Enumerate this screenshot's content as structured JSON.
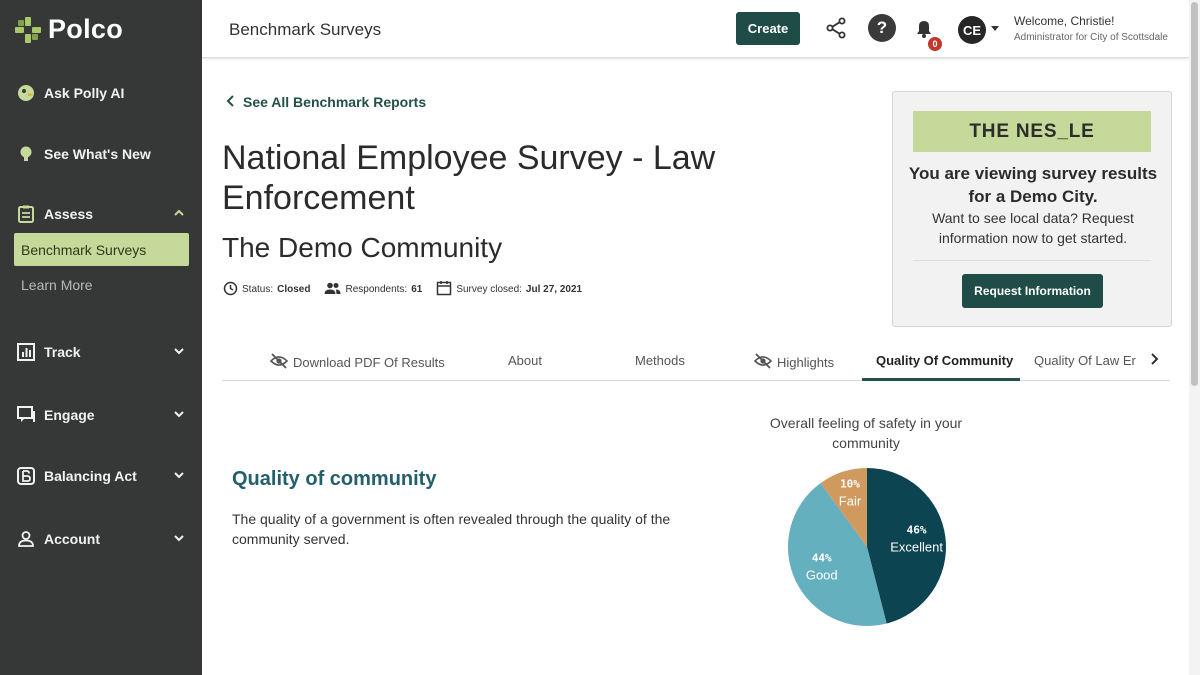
{
  "sidebar": {
    "logo": "Polco",
    "items": [
      {
        "label": "Ask Polly AI"
      },
      {
        "label": "See What's New"
      },
      {
        "label": "Assess"
      },
      {
        "label": "Track"
      },
      {
        "label": "Engage"
      },
      {
        "label": "Balancing Act"
      },
      {
        "label": "Account"
      }
    ],
    "assess_sub": {
      "active": "Benchmark Surveys",
      "other": "Learn More"
    }
  },
  "header": {
    "title": "Benchmark Surveys",
    "create_label": "Create",
    "notification_count": "0",
    "avatar_initials": "CE",
    "welcome": "Welcome, Christie!",
    "role": "Administrator for City of Scottsdale"
  },
  "main": {
    "back_link": "See All Benchmark Reports",
    "survey_title": "National Employee Survey - Law Enforcement",
    "community": "The Demo Community",
    "meta": {
      "status_label": "Status:",
      "status": "Closed",
      "respondents_label": "Respondents:",
      "respondents": "61",
      "closed_label": "Survey closed:",
      "closed": "Jul 27, 2021"
    },
    "tabs": [
      "Download PDF Of Results",
      "About",
      "Methods",
      "Highlights",
      "Quality Of Community",
      "Quality Of Law Er"
    ],
    "section": {
      "title": "Quality of community",
      "description": "The quality of a government is often revealed through the quality of the community served."
    }
  },
  "demo_card": {
    "banner": "THE NES_LE",
    "headline": "You are viewing survey results for a Demo City.",
    "body": "Want to see local data? Request information now to get started.",
    "button": "Request Information"
  },
  "chart_data": {
    "type": "pie",
    "title": "Overall feeling of safety in your community",
    "categories": [
      "Excellent",
      "Good",
      "Fair"
    ],
    "values": [
      46,
      44,
      10
    ],
    "value_labels": [
      "46%",
      "44%",
      "10%"
    ],
    "colors": [
      "#0d4452",
      "#64b0bf",
      "#d09a5f"
    ]
  }
}
